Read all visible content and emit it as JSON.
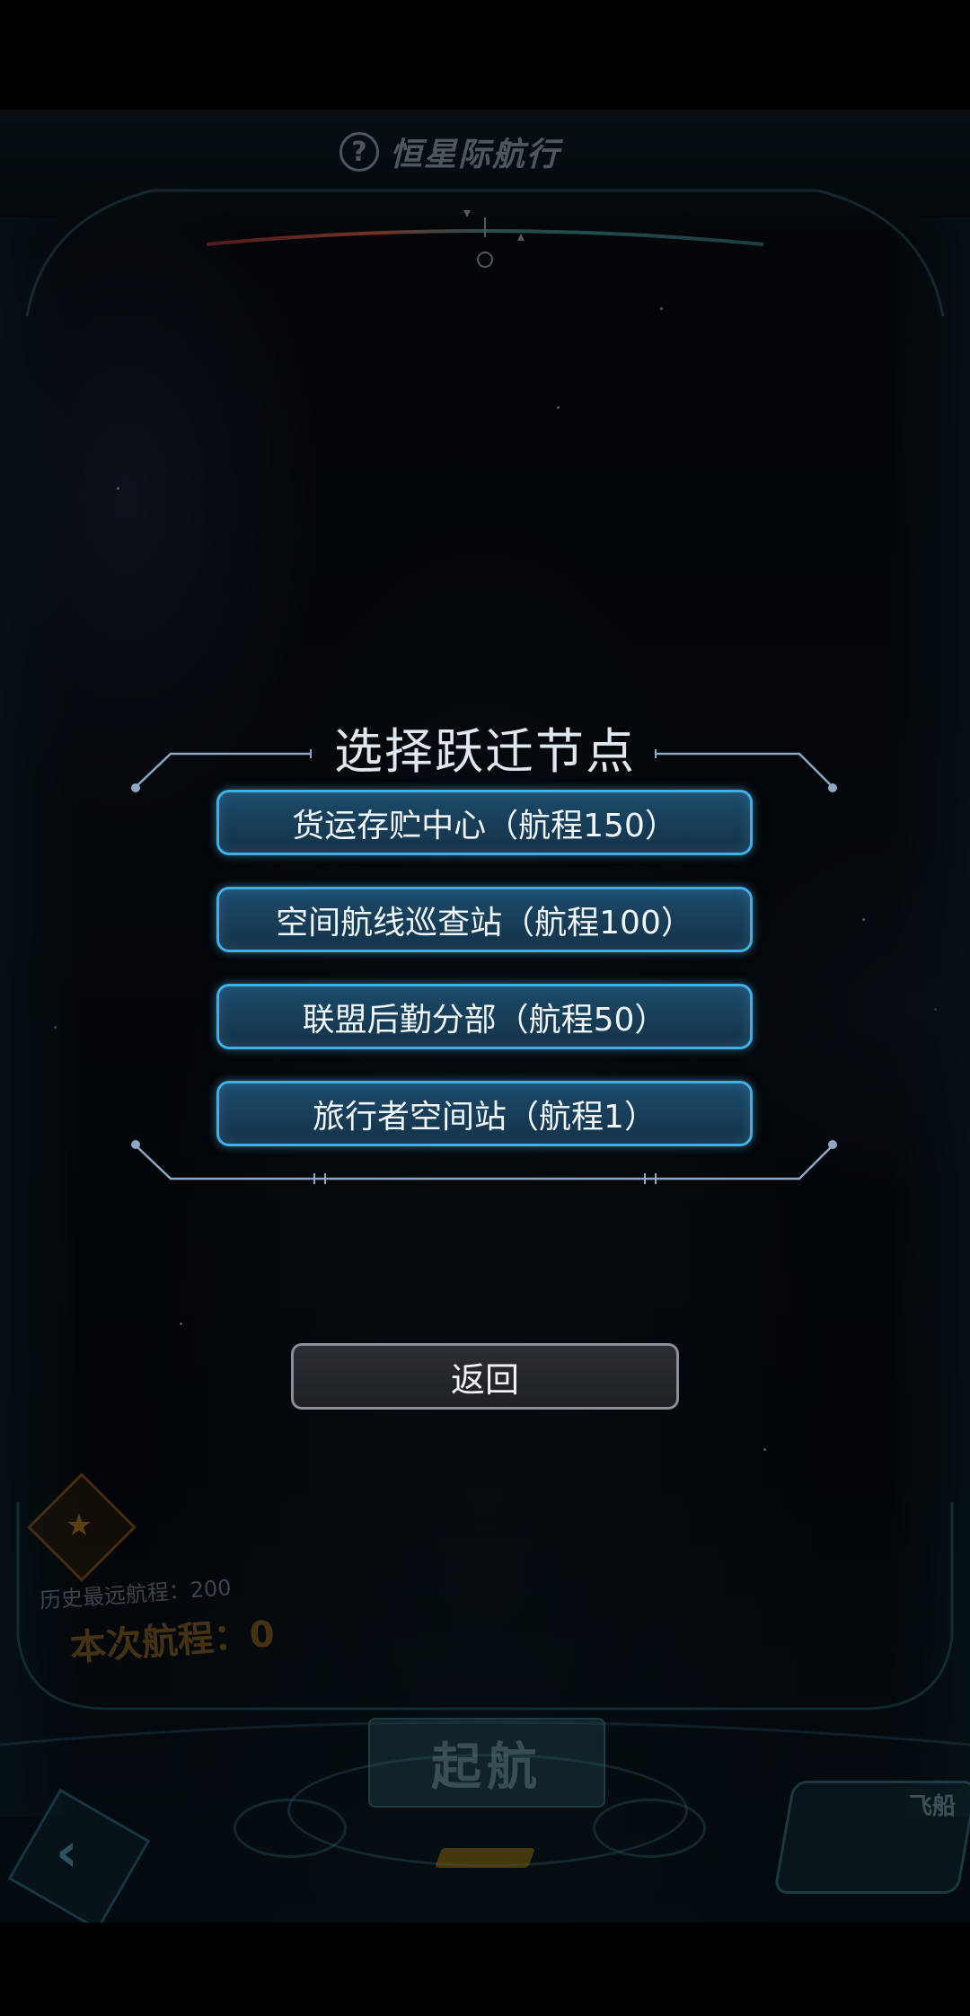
{
  "header": {
    "title": "恒星际航行",
    "help_icon": "question-circle-icon"
  },
  "modal": {
    "title": "选择跃迁节点",
    "options": [
      {
        "label": "货运存贮中心（航程150）"
      },
      {
        "label": "空间航线巡查站（航程100）"
      },
      {
        "label": "联盟后勤分部（航程50）"
      },
      {
        "label": "旅行者空间站（航程1）"
      }
    ],
    "back_label": "返回"
  },
  "hud": {
    "record_label": "历史最远航程：200",
    "current_label": "本次航程：0",
    "launch_label": "起航",
    "ship_label": "飞船",
    "gift_icon": "gift-star-icon",
    "back_icon": "chevron-left-icon"
  },
  "colors": {
    "option_border": "#3fb0e8",
    "option_fill": "#1a4663",
    "back_border": "#8b8f95",
    "hud_accent": "#be822a"
  }
}
